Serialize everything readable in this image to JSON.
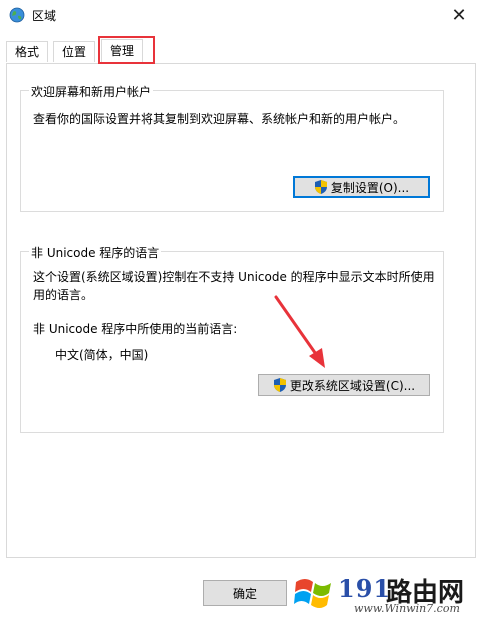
{
  "window": {
    "title": "区域",
    "close_glyph": "✕"
  },
  "tabs": [
    {
      "label": "格式"
    },
    {
      "label": "位置"
    },
    {
      "label": "管理"
    }
  ],
  "active_tab": "管理",
  "welcome_group": {
    "label": "欢迎屏幕和新用户帐户",
    "description": "查看你的国际设置并将其复制到欢迎屏幕、系统帐户和新的用户帐户。",
    "copy_button": "复制设置(O)..."
  },
  "unicode_group": {
    "label": "非 Unicode 程序的语言",
    "description_line1": "这个设置(系统区域设置)控制在不支持 Unicode 的程序中显示文本时所使用",
    "description_line2": "用的语言。",
    "current_language_label": "非 Unicode 程序中所使用的当前语言:",
    "current_language_value": "中文(简体，中国)",
    "change_button": "更改系统区域设置(C)..."
  },
  "footer": {
    "ok_button": "确定"
  },
  "watermark": {
    "number": "191",
    "brand": "路由网",
    "url": "www.Winwin7.com"
  },
  "colors": {
    "highlight": "#e8333a",
    "arrow": "#e8333a",
    "focus": "#0078d7"
  },
  "icons": {
    "app": "globe-icon",
    "close": "close-icon",
    "shield": "uac-shield-icon"
  }
}
